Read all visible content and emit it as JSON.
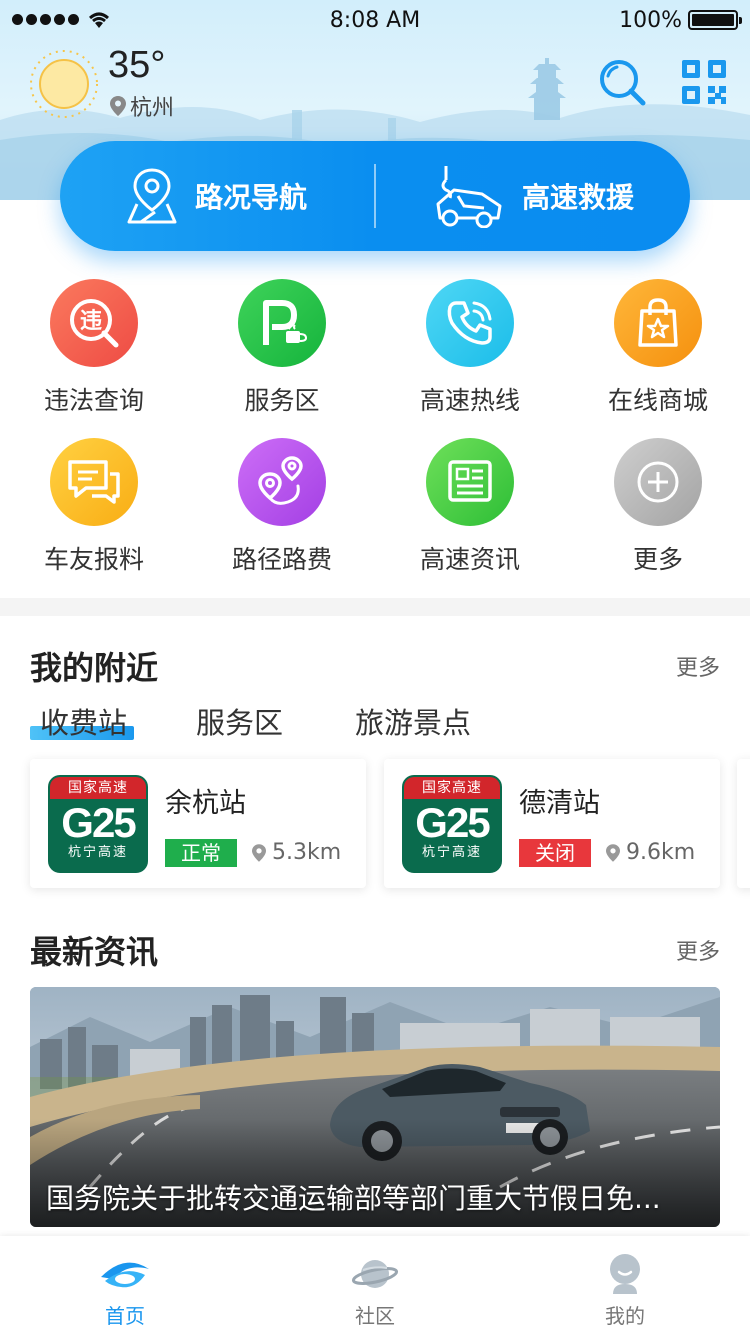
{
  "status_bar": {
    "time": "8:08 AM",
    "battery": "100%"
  },
  "weather": {
    "temperature": "35°",
    "city": "杭州"
  },
  "header": {
    "search_icon": "search-icon",
    "qr_icon": "qr-code-icon"
  },
  "actions": [
    {
      "label": "路况导航",
      "icon": "map-pin-icon"
    },
    {
      "label": "高速救援",
      "icon": "tow-truck-icon"
    }
  ],
  "grid": [
    {
      "label": "违法查询",
      "icon": "violation-search-icon",
      "color": "#f2594b"
    },
    {
      "label": "服务区",
      "icon": "parking-coffee-icon",
      "color": "#1fc24a"
    },
    {
      "label": "高速热线",
      "icon": "phone-icon",
      "color": "#2ec9ee"
    },
    {
      "label": "在线商城",
      "icon": "shopping-bag-icon",
      "color": "#fba01c"
    },
    {
      "label": "车友报料",
      "icon": "chat-icon",
      "color": "#fcbd22"
    },
    {
      "label": "路径路费",
      "icon": "route-icon",
      "color": "#b650ea"
    },
    {
      "label": "高速资讯",
      "icon": "news-icon",
      "color": "#46d14c"
    },
    {
      "label": "更多",
      "icon": "plus-circle-icon",
      "color": "#b5b5b5"
    }
  ],
  "nearby": {
    "title": "我的附近",
    "more": "更多",
    "tabs": [
      "收费站",
      "服务区",
      "旅游景点"
    ],
    "active_tab": 0,
    "cards": [
      {
        "plate_top": "国家高速",
        "plate_code": "G25",
        "plate_sub": "杭宁高速",
        "name": "余杭站",
        "status": "正常",
        "status_color": "#1fae4c",
        "distance": "5.3km"
      },
      {
        "plate_top": "国家高速",
        "plate_code": "G25",
        "plate_sub": "杭宁高速",
        "name": "德清站",
        "status": "关闭",
        "status_color": "#e8373c",
        "distance": "9.6km"
      }
    ]
  },
  "news": {
    "title": "最新资讯",
    "more": "更多",
    "headline": "国务院关于批转交通运输部等部门重大节假日免..."
  },
  "tabbar": [
    {
      "label": "首页",
      "icon": "home-wave-icon",
      "active": true
    },
    {
      "label": "社区",
      "icon": "planet-icon",
      "active": false
    },
    {
      "label": "我的",
      "icon": "user-icon",
      "active": false
    }
  ],
  "colors": {
    "accent": "#0a8ef0",
    "tab_active": "#1a96ee"
  }
}
